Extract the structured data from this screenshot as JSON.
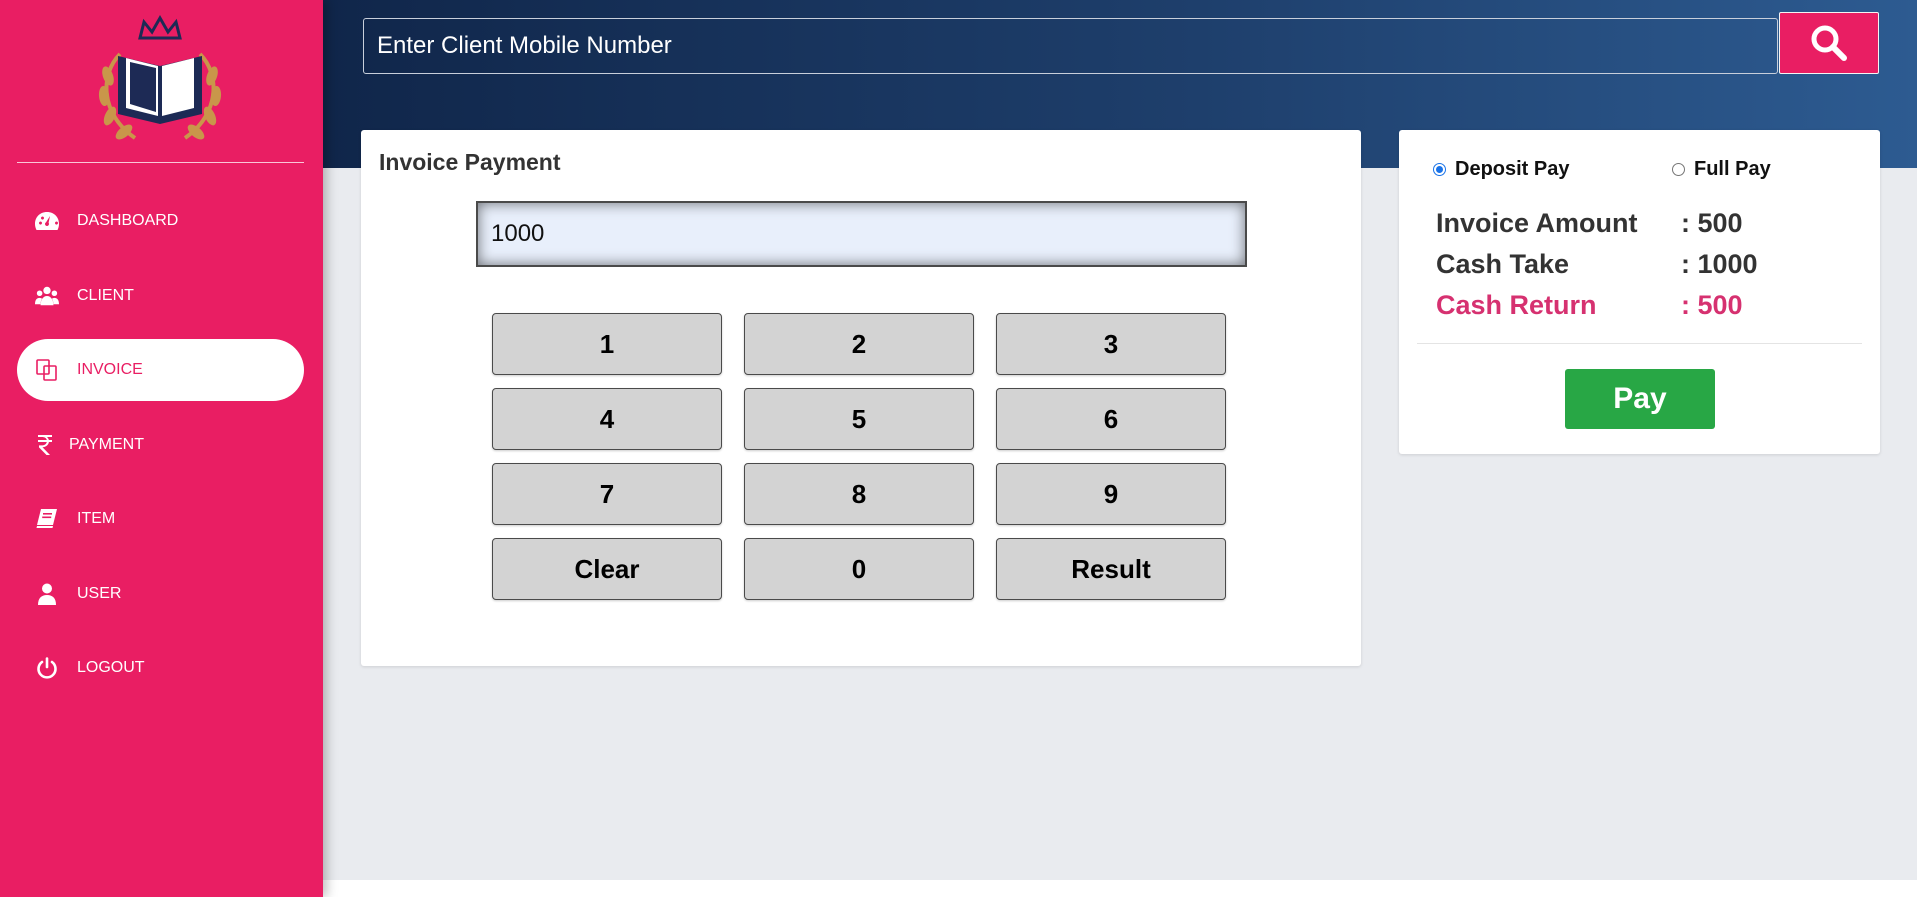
{
  "search": {
    "placeholder": "Enter Client Mobile Number",
    "icon": "search-icon"
  },
  "sidebar": {
    "logo": "book-crown-laurel-logo",
    "items": [
      {
        "label": "DASHBOARD",
        "icon": "dashboard-icon",
        "active": false
      },
      {
        "label": "CLIENT",
        "icon": "users-icon",
        "active": false
      },
      {
        "label": "INVOICE",
        "icon": "copy-icon",
        "active": true
      },
      {
        "label": "PAYMENT",
        "icon": "rupee-icon",
        "active": false
      },
      {
        "label": "ITEM",
        "icon": "book-icon",
        "active": false
      },
      {
        "label": "USER",
        "icon": "user-icon",
        "active": false
      },
      {
        "label": "LOGOUT",
        "icon": "power-icon",
        "active": false
      }
    ]
  },
  "invoice": {
    "title": "Invoice Payment",
    "display_value": "1000",
    "keys": [
      "1",
      "2",
      "3",
      "4",
      "5",
      "6",
      "7",
      "8",
      "9",
      "Clear",
      "0",
      "Result"
    ]
  },
  "summary": {
    "pay_options": [
      {
        "label": "Deposit Pay",
        "checked": true
      },
      {
        "label": "Full Pay",
        "checked": false
      }
    ],
    "rows": [
      {
        "label": "Invoice Amount",
        "value": ": 500"
      },
      {
        "label": "Cash Take",
        "value": ": 1000"
      },
      {
        "label": "Cash Return",
        "value": ": 500"
      }
    ],
    "pay_label": "Pay"
  },
  "colors": {
    "brand": "#e91e63",
    "header_dark": "#10264a",
    "header_light": "#2d5b91",
    "success": "#28a745",
    "highlight": "#d63170",
    "page_bg": "#e9ebef"
  }
}
